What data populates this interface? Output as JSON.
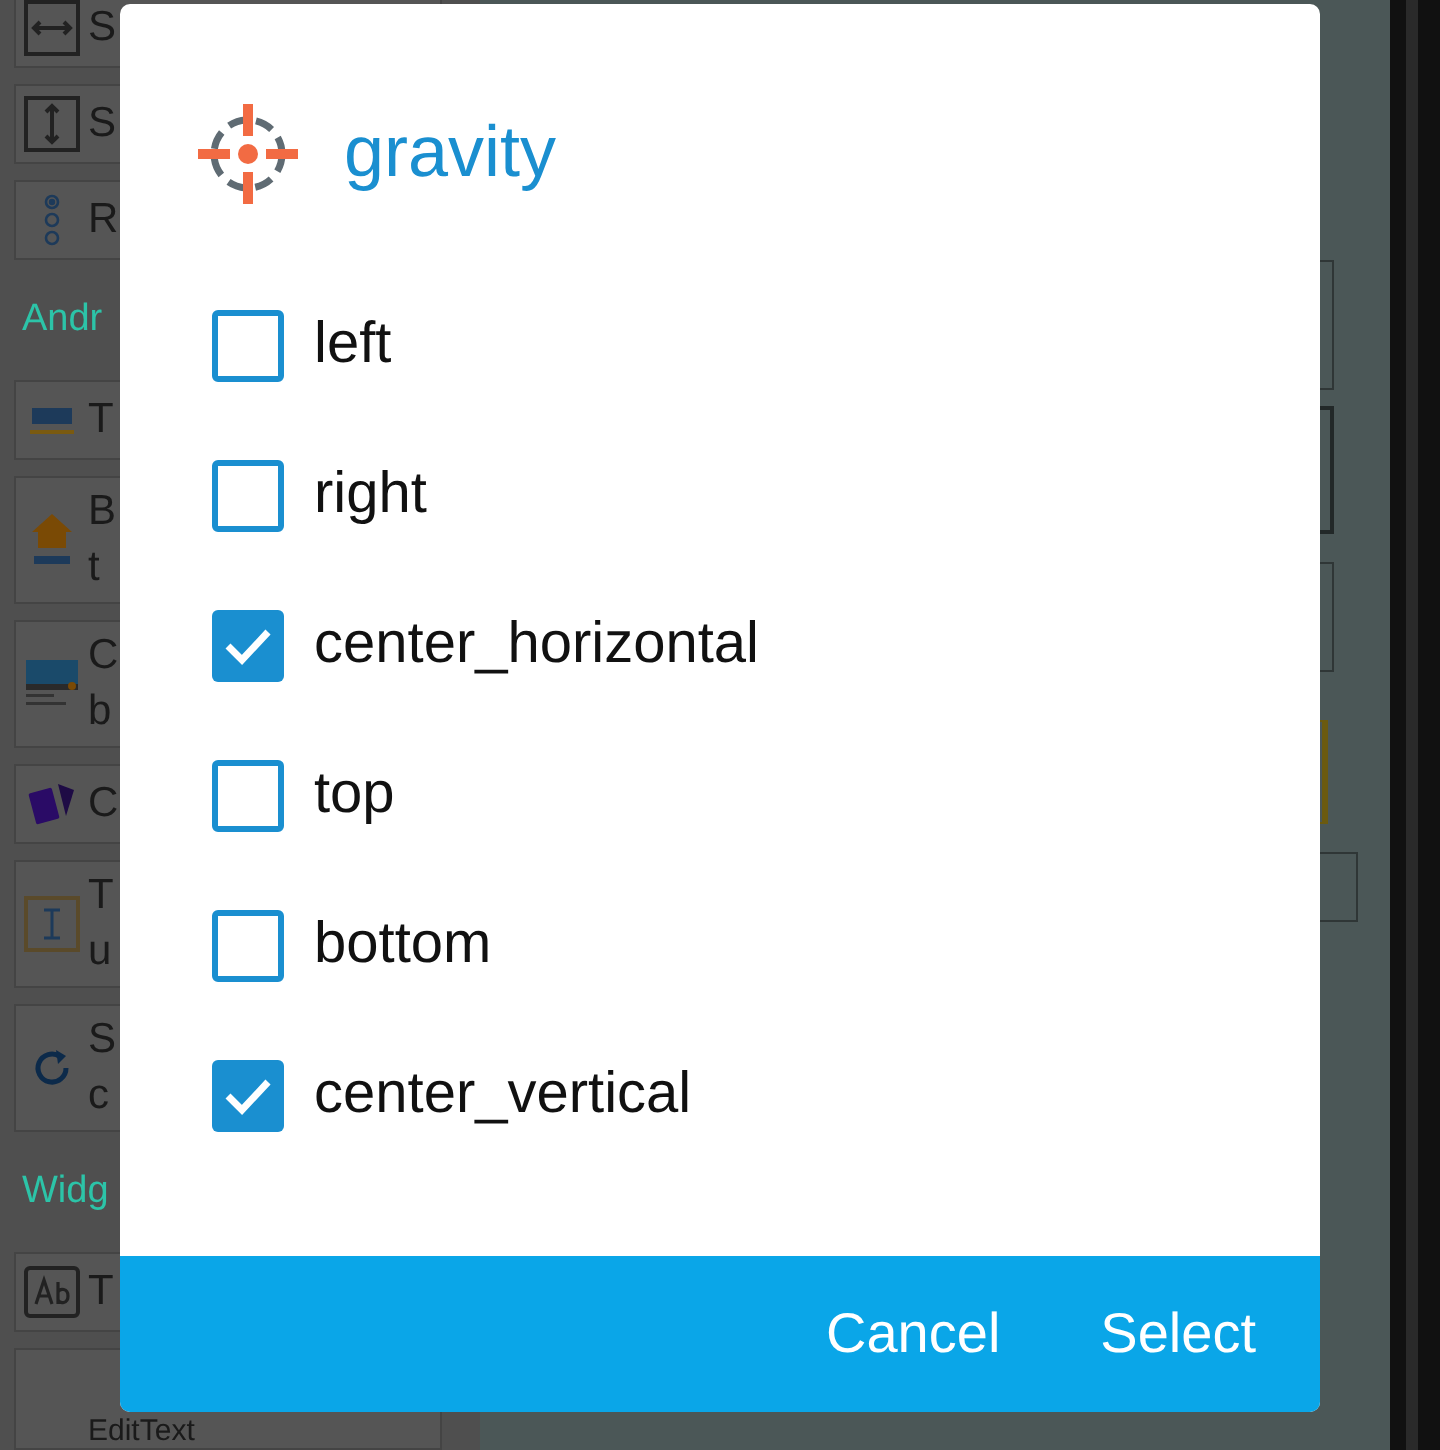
{
  "palette": [
    {
      "kind": "item",
      "lines": [
        "S"
      ]
    },
    {
      "kind": "item",
      "lines": [
        "S"
      ]
    },
    {
      "kind": "item",
      "lines": [
        "R"
      ]
    },
    {
      "kind": "heading",
      "lines": [
        "Andr"
      ]
    },
    {
      "kind": "item",
      "lines": [
        "T"
      ]
    },
    {
      "kind": "item",
      "lines": [
        "B",
        "t"
      ]
    },
    {
      "kind": "item",
      "lines": [
        "C",
        "b"
      ]
    },
    {
      "kind": "item",
      "lines": [
        "C"
      ]
    },
    {
      "kind": "item",
      "lines": [
        "T",
        "u"
      ]
    },
    {
      "kind": "item",
      "lines": [
        "S",
        "c"
      ]
    },
    {
      "kind": "heading",
      "lines": [
        "Widg"
      ]
    },
    {
      "kind": "item",
      "lines": [
        "T"
      ]
    },
    {
      "kind": "item",
      "lines": [
        "EditText"
      ]
    }
  ],
  "dialog": {
    "title": "gravity",
    "options": [
      {
        "label": "left",
        "checked": false
      },
      {
        "label": "right",
        "checked": false
      },
      {
        "label": "center_horizontal",
        "checked": true
      },
      {
        "label": "top",
        "checked": false
      },
      {
        "label": "bottom",
        "checked": false
      },
      {
        "label": "center_vertical",
        "checked": true
      }
    ],
    "buttons": [
      "Cancel",
      "Select"
    ]
  }
}
